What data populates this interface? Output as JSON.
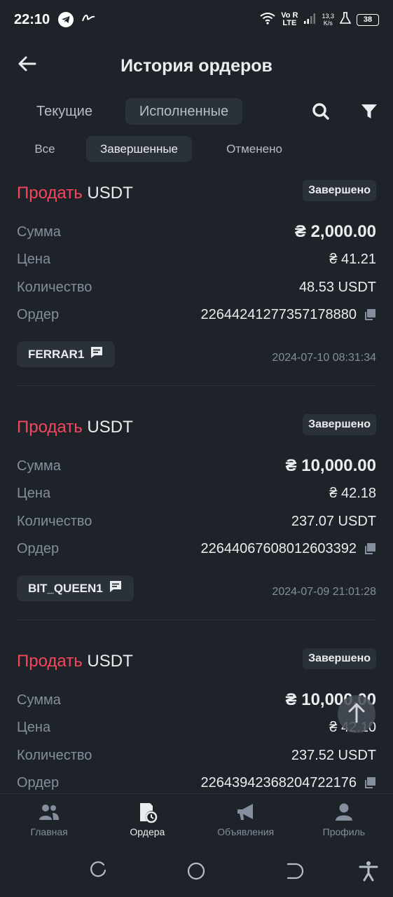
{
  "status_bar": {
    "time": "22:10",
    "net_top": "Vo R",
    "net_bottom": "LTE",
    "speed_top": "13,3",
    "speed_bottom": "K/s",
    "battery": "38"
  },
  "header": {
    "title": "История ордеров"
  },
  "tabs": {
    "current": "Текущие",
    "done": "Исполненные"
  },
  "subtabs": {
    "all": "Все",
    "completed": "Завершенные",
    "cancelled": "Отменено"
  },
  "labels": {
    "amount": "Сумма",
    "price": "Цена",
    "quantity": "Количество",
    "order": "Ордер"
  },
  "orders": [
    {
      "side": "Продать",
      "asset": "USDT",
      "status": "Завершено",
      "amount": "₴ 2,000.00",
      "price": "₴ 41.21",
      "quantity": "48.53 USDT",
      "order_id": "22644241277357178880",
      "counterparty": "FERRAR1",
      "timestamp": "2024-07-10 08:31:34"
    },
    {
      "side": "Продать",
      "asset": "USDT",
      "status": "Завершено",
      "amount": "₴ 10,000.00",
      "price": "₴ 42.18",
      "quantity": "237.07 USDT",
      "order_id": "22644067608012603392",
      "counterparty": "BIT_QUEEN1",
      "timestamp": "2024-07-09 21:01:28"
    },
    {
      "side": "Продать",
      "asset": "USDT",
      "status": "Завершено",
      "amount": "₴ 10,000.00",
      "price": "₴ 42.10",
      "quantity": "237.52 USDT",
      "order_id": "22643942368204722176",
      "counterparty": "",
      "timestamp": ""
    }
  ],
  "bottom_nav": [
    {
      "label": "Главная",
      "icon": "people-icon",
      "active": false
    },
    {
      "label": "Ордера",
      "icon": "orders-clock-icon",
      "active": true
    },
    {
      "label": "Объявления",
      "icon": "megaphone-icon",
      "active": false
    },
    {
      "label": "Профиль",
      "icon": "person-icon",
      "active": false
    }
  ],
  "colors": {
    "background": "#1e2329",
    "sell": "#f6465d",
    "surface": "#2b3139",
    "muted": "#848e9c"
  }
}
